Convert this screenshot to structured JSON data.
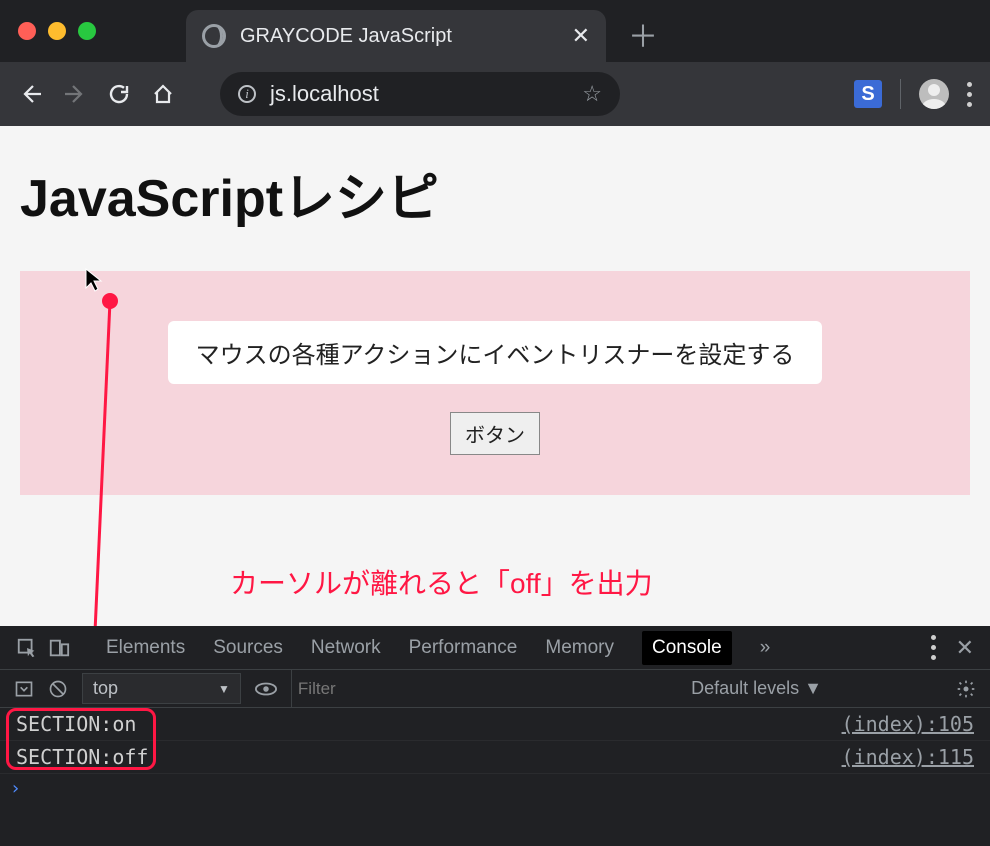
{
  "browser": {
    "tab_title": "GRAYCODE JavaScript",
    "url": "js.localhost",
    "extension_label": "S"
  },
  "page": {
    "heading": "JavaScriptレシピ",
    "section_text": "マウスの各種アクションにイベントリスナーを設定する",
    "button_label": "ボタン"
  },
  "annotation": {
    "text": "カーソルが離れると「off」を出力"
  },
  "devtools": {
    "tabs": {
      "elements": "Elements",
      "sources": "Sources",
      "network": "Network",
      "performance": "Performance",
      "memory": "Memory",
      "console": "Console",
      "more": "»"
    },
    "context": "top",
    "filter_placeholder": "Filter",
    "levels": "Default levels ▼",
    "log": [
      {
        "msg": "SECTION:on",
        "src": "(index):105"
      },
      {
        "msg": "SECTION:off",
        "src": "(index):115"
      }
    ]
  }
}
